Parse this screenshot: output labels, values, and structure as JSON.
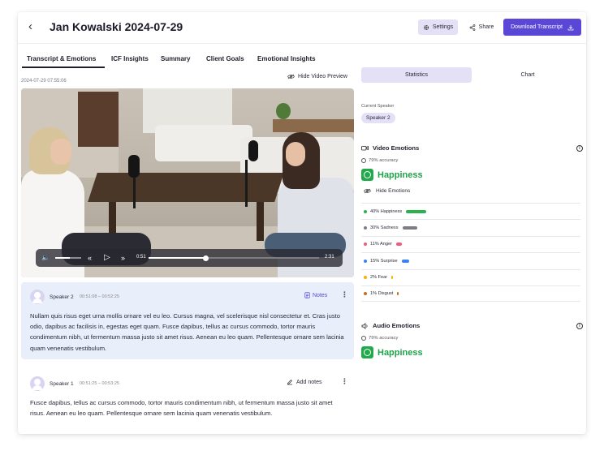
{
  "header": {
    "title": "Jan Kowalski 2024-07-29",
    "settings_label": "Settings",
    "share_label": "Share",
    "download_label": "Download Transcript"
  },
  "tabs": [
    {
      "label": "Transcript & Emotions",
      "active": true
    },
    {
      "label": "ICF Insights"
    },
    {
      "label": "Summary"
    },
    {
      "label": "Client Goals"
    },
    {
      "label": "Emotional Insights"
    }
  ],
  "video": {
    "timestamp": "2024-07-29 07:55:06",
    "hide_label": "Hide Video Preview",
    "current_time": "0:51",
    "duration": "2:31",
    "progress": 0.338,
    "volume": 0.55
  },
  "segments": [
    {
      "speaker": "Speaker 2",
      "time": "00:51:08 – 00:52:25",
      "notes_label": "Notes",
      "text": "Nullam quis risus eget urna mollis ornare vel eu leo. Cursus magna, vel scelerisque nisl consectetur et. Cras justo odio, dapibus ac facilisis in, egestas eget quam. Fusce dapibus, tellus ac cursus commodo, tortor mauris condimentum nibh, ut fermentum massa justo sit amet risus. Aenean eu leo quam. Pellentesque ornare sem lacinia quam venenatis vestibulum."
    },
    {
      "speaker": "Speaker 1",
      "time": "00:51:25 – 00:53:25",
      "notes_label": "Add notes",
      "text": "Fusce dapibus, tellus ac cursus commodo, tortor mauris condimentum nibh, ut fermentum massa justo sit amet risus. Aenean eu leo quam. Pellentesque ornare sem lacinia quam venenatis vestibulum."
    }
  ],
  "panel": {
    "segment_statistics": "Statistics",
    "segment_chart": "Chart",
    "current_speaker_label": "Current Speaker",
    "current_speaker": "Speaker 2",
    "video_emotions": {
      "title": "Video Emotions",
      "accuracy": "79% accuracy",
      "main_emotion": "Happiness",
      "hide_label": "Hide Emotions",
      "items": [
        {
          "label": "40% Happiness",
          "percent": 40,
          "color": "#2bb24c"
        },
        {
          "label": "30% Sadness",
          "percent": 30,
          "color": "#7d7d85"
        },
        {
          "label": "11% Anger",
          "percent": 11,
          "color": "#f05a7e"
        },
        {
          "label": "15% Surprise",
          "percent": 15,
          "color": "#3b82f6"
        },
        {
          "label": "2% Fear",
          "percent": 2,
          "color": "#f5b400"
        },
        {
          "label": "1% Disgust",
          "percent": 1,
          "color": "#c2701c"
        }
      ]
    },
    "audio_emotions": {
      "title": "Audio Emotions",
      "accuracy": "79% accuracy",
      "main_emotion": "Happiness"
    }
  },
  "colors": {
    "accent": "#5b47d6",
    "accent_soft": "#e4e1f7",
    "happiness_green": "#22a94b",
    "segment_highlight": "#e9eefb"
  }
}
